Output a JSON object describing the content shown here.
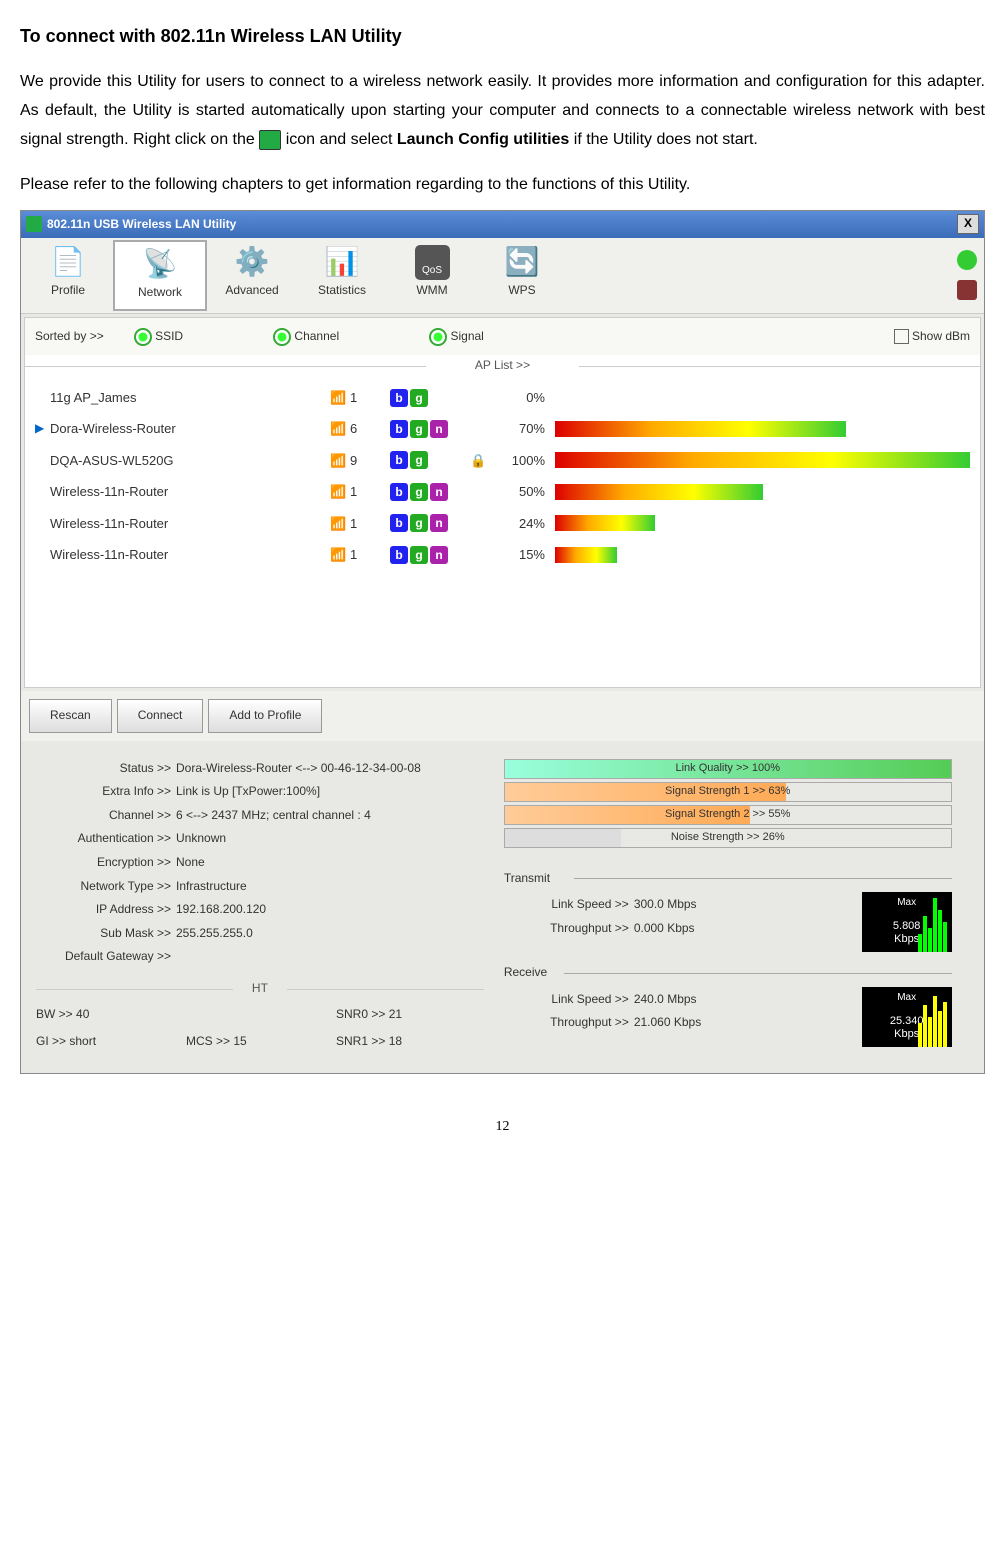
{
  "doc": {
    "heading": "To connect with 802.11n Wireless LAN Utility",
    "para1a": "We provide this Utility for users to connect to a wireless network easily. It provides more information and configuration for this adapter. As default, the Utility is started automatically upon starting your computer and connects to a connectable wireless network with best signal strength. Right click on the ",
    "para1b": " icon and select ",
    "launch_bold": "Launch Config utilities",
    "para1c": " if the Utility does not start.",
    "para2": "Please refer to the following chapters to get information regarding to the functions of this Utility.",
    "page_num": "12"
  },
  "window": {
    "title": "802.11n USB Wireless LAN Utility",
    "close": "X",
    "tabs": [
      "Profile",
      "Network",
      "Advanced",
      "Statistics",
      "WMM",
      "WPS"
    ],
    "sort_label": "Sorted by >>",
    "sort_ssid": "SSID",
    "sort_channel": "Channel",
    "sort_signal": "Signal",
    "show_dbm": "Show dBm",
    "ap_list_label": "AP List >>",
    "aps": [
      {
        "arrow": "",
        "ssid": "11g AP_James",
        "ch": "1",
        "badges": [
          "b",
          "g"
        ],
        "lock": "",
        "signal": "0%",
        "bar": 0
      },
      {
        "arrow": "▶",
        "ssid": "Dora-Wireless-Router",
        "ch": "6",
        "badges": [
          "b",
          "g",
          "n"
        ],
        "lock": "",
        "signal": "70%",
        "bar": 70
      },
      {
        "arrow": "",
        "ssid": "DQA-ASUS-WL520G",
        "ch": "9",
        "badges": [
          "b",
          "g"
        ],
        "lock": "🔒",
        "signal": "100%",
        "bar": 100
      },
      {
        "arrow": "",
        "ssid": "Wireless-11n-Router",
        "ch": "1",
        "badges": [
          "b",
          "g",
          "n"
        ],
        "lock": "",
        "signal": "50%",
        "bar": 50
      },
      {
        "arrow": "",
        "ssid": "Wireless-11n-Router",
        "ch": "1",
        "badges": [
          "b",
          "g",
          "n"
        ],
        "lock": "",
        "signal": "24%",
        "bar": 24
      },
      {
        "arrow": "",
        "ssid": "Wireless-11n-Router",
        "ch": "1",
        "badges": [
          "b",
          "g",
          "n"
        ],
        "lock": "",
        "signal": "15%",
        "bar": 15
      }
    ],
    "btn_rescan": "Rescan",
    "btn_connect": "Connect",
    "btn_add": "Add to Profile",
    "status": {
      "status_lbl": "Status >>",
      "status_val": "Dora-Wireless-Router <--> 00-46-12-34-00-08",
      "extra_lbl": "Extra Info >>",
      "extra_val": "Link is Up [TxPower:100%]",
      "channel_lbl": "Channel >>",
      "channel_val": "6 <--> 2437 MHz; central channel : 4",
      "auth_lbl": "Authentication >>",
      "auth_val": "Unknown",
      "enc_lbl": "Encryption >>",
      "enc_val": "None",
      "net_lbl": "Network Type >>",
      "net_val": "Infrastructure",
      "ip_lbl": "IP Address >>",
      "ip_val": "192.168.200.120",
      "mask_lbl": "Sub Mask >>",
      "mask_val": "255.255.255.0",
      "gw_lbl": "Default Gateway >>",
      "gw_val": ""
    },
    "ht_label": "HT",
    "ht": {
      "bw_lbl": "BW >>",
      "bw_val": "40",
      "snr0_lbl": "SNR0 >>",
      "snr0_val": "21",
      "gi_lbl": "GI >>",
      "gi_val": "short",
      "mcs_lbl": "MCS >>",
      "mcs_val": "15",
      "snr1_lbl": "SNR1 >>",
      "snr1_val": "18"
    },
    "strength": {
      "link_quality": "Link Quality >> 100%",
      "sig1": "Signal Strength 1 >> 63%",
      "sig2": "Signal Strength 2 >> 55%",
      "noise": "Noise Strength >> 26%"
    },
    "transmit_lbl": "Transmit",
    "receive_lbl": "Receive",
    "tx": {
      "speed_lbl": "Link Speed >>",
      "speed_val": "300.0 Mbps",
      "thru_lbl": "Throughput >>",
      "thru_val": "0.000 Kbps",
      "max": "Max",
      "graph_val": "5.808",
      "graph_unit": "Kbps"
    },
    "rx": {
      "speed_lbl": "Link Speed >>",
      "speed_val": "240.0 Mbps",
      "thru_lbl": "Throughput >>",
      "thru_val": "21.060 Kbps",
      "max": "Max",
      "graph_val": "25.340",
      "graph_unit": "Kbps"
    }
  }
}
